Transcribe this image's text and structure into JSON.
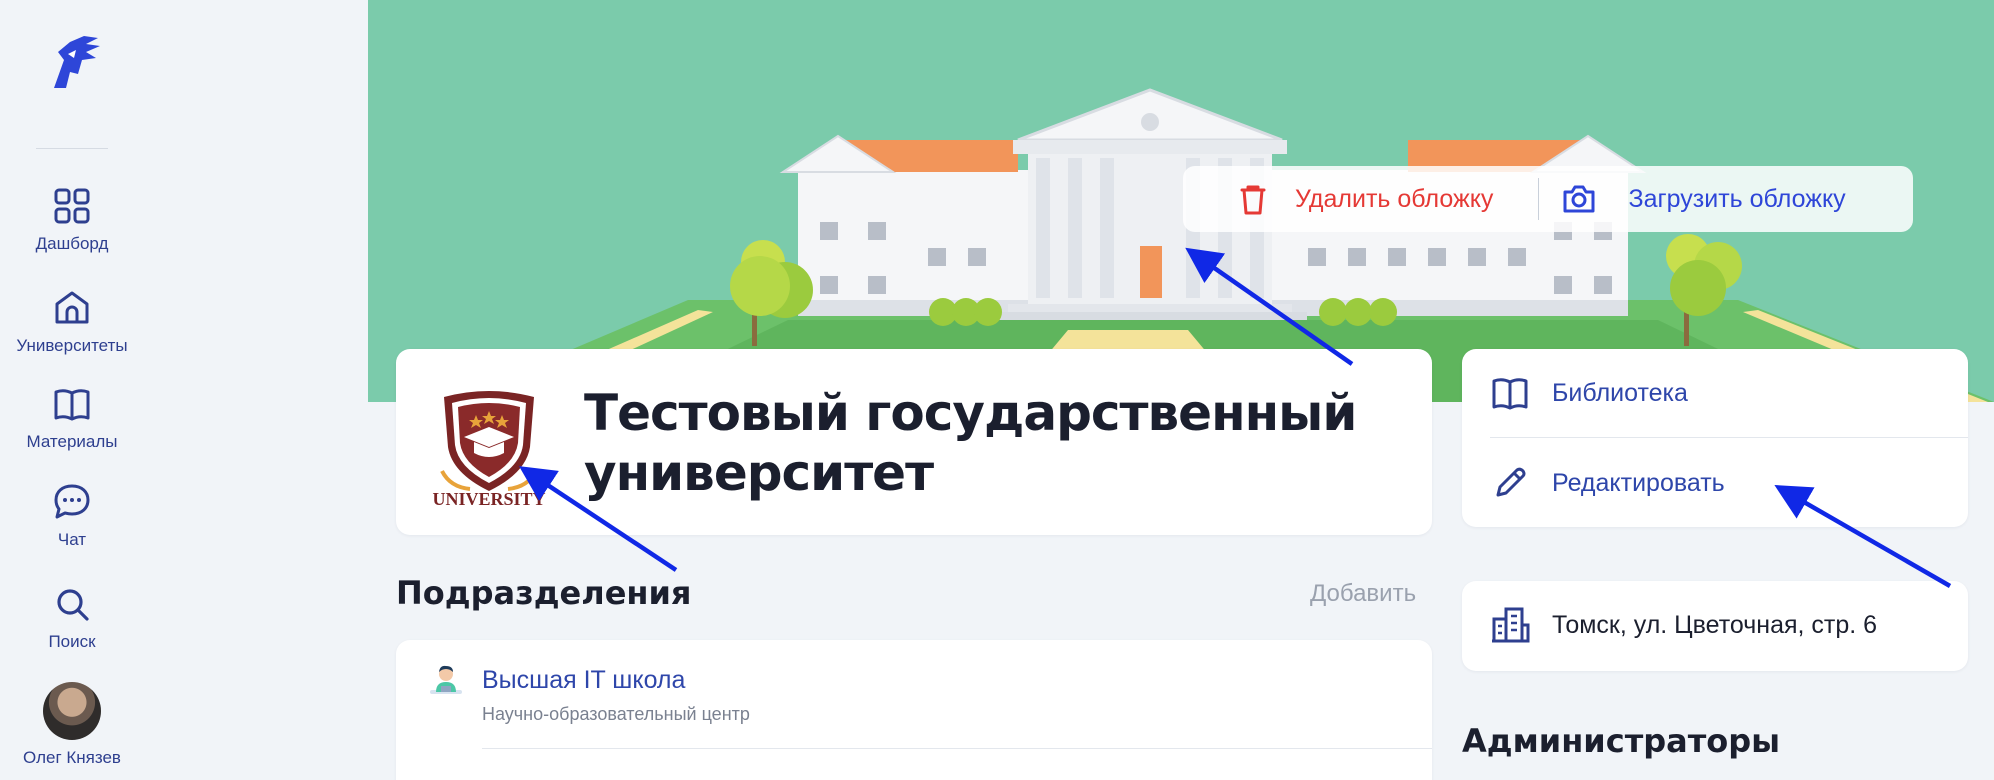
{
  "sidebar": {
    "items": [
      {
        "label": "Дашборд",
        "icon": "grid-icon"
      },
      {
        "label": "Университеты",
        "icon": "university-home-icon"
      },
      {
        "label": "Материалы",
        "icon": "book-icon"
      },
      {
        "label": "Чат",
        "icon": "chat-icon"
      },
      {
        "label": "Поиск",
        "icon": "search-icon"
      }
    ],
    "user_name": "Олег Князев"
  },
  "cover": {
    "delete_label": "Удалить обложку",
    "upload_label": "Загрузить обложку"
  },
  "university": {
    "title": "Тестовый государственный университет",
    "logo_text": "UNIVERSITY"
  },
  "divisions": {
    "title": "Подразделения",
    "add_label": "Добавить",
    "items": [
      {
        "name": "Высшая IT школа",
        "subtitle": "Научно-образовательный центр"
      }
    ]
  },
  "actions": {
    "library_label": "Библиотека",
    "edit_label": "Редактировать"
  },
  "address": "Томск, ул. Цветочная, стр. 6",
  "admins_title": "Администраторы",
  "colors": {
    "accent": "#2E46AA",
    "danger": "#E53935",
    "cover_bg": "#7BCBAB",
    "page_bg": "#F1F4F8"
  }
}
